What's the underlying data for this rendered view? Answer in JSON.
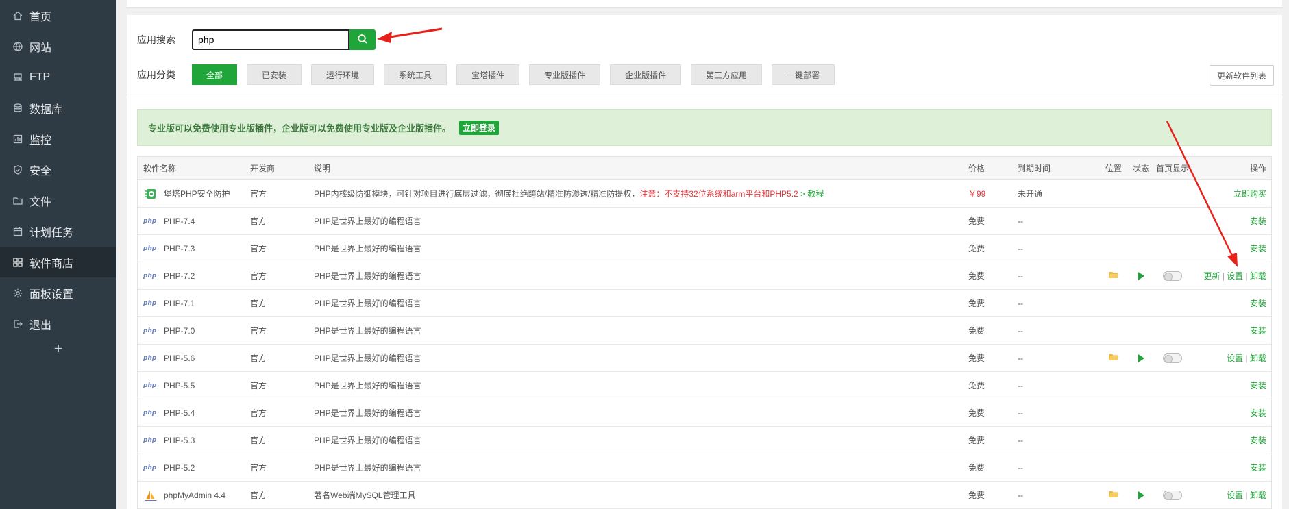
{
  "sidebar": {
    "items": [
      {
        "label": "首页",
        "icon": "home-icon"
      },
      {
        "label": "网站",
        "icon": "globe-icon"
      },
      {
        "label": "FTP",
        "icon": "ftp-icon"
      },
      {
        "label": "数据库",
        "icon": "database-icon"
      },
      {
        "label": "监控",
        "icon": "monitor-icon"
      },
      {
        "label": "安全",
        "icon": "shield-icon"
      },
      {
        "label": "文件",
        "icon": "folder-icon"
      },
      {
        "label": "计划任务",
        "icon": "calendar-icon"
      },
      {
        "label": "软件商店",
        "icon": "grid-icon"
      },
      {
        "label": "面板设置",
        "icon": "gear-icon"
      },
      {
        "label": "退出",
        "icon": "logout-icon"
      }
    ],
    "active_index": 8,
    "add_label": "+"
  },
  "search": {
    "label": "应用搜索",
    "value": "php"
  },
  "categories": {
    "label": "应用分类",
    "items": [
      "全部",
      "已安装",
      "运行环境",
      "系统工具",
      "宝塔插件",
      "专业版插件",
      "企业版插件",
      "第三方应用",
      "一键部署"
    ],
    "active_index": 0,
    "update_label": "更新软件列表"
  },
  "notice": {
    "text": "专业版可以免费使用专业版插件，企业版可以免费使用专业版及企业版插件。",
    "login_label": "立即登录"
  },
  "table": {
    "headers": {
      "name": "软件名称",
      "dev": "开发商",
      "desc": "说明",
      "price": "价格",
      "expire": "到期时间",
      "position": "位置",
      "state": "状态",
      "home": "首页显示",
      "op": "操作"
    },
    "rows": [
      {
        "name": "堡塔PHP安全防护",
        "dev": "官方",
        "desc": "PHP内核级防御模块，可针对项目进行底层过滤，彻底杜绝跨站/精准防渗透/精准防提权，",
        "warn": "注意：不支持32位系统和arm平台和PHP5.2",
        "link": " > 教程",
        "price": "￥99",
        "expire": "未开通",
        "op": "立即购买"
      },
      {
        "name": "PHP-7.4",
        "dev": "官方",
        "desc": "PHP是世界上最好的编程语言",
        "price": "免费",
        "expire": "--",
        "op": "安装"
      },
      {
        "name": "PHP-7.3",
        "dev": "官方",
        "desc": "PHP是世界上最好的编程语言",
        "price": "免费",
        "expire": "--",
        "op": "安装"
      },
      {
        "name": "PHP-7.2",
        "dev": "官方",
        "desc": "PHP是世界上最好的编程语言",
        "price": "免费",
        "expire": "--",
        "op_update": "更新",
        "op_settings": "设置",
        "op_uninstall": "卸载"
      },
      {
        "name": "PHP-7.1",
        "dev": "官方",
        "desc": "PHP是世界上最好的编程语言",
        "price": "免费",
        "expire": "--",
        "op": "安装"
      },
      {
        "name": "PHP-7.0",
        "dev": "官方",
        "desc": "PHP是世界上最好的编程语言",
        "price": "免费",
        "expire": "--",
        "op": "安装"
      },
      {
        "name": "PHP-5.6",
        "dev": "官方",
        "desc": "PHP是世界上最好的编程语言",
        "price": "免费",
        "expire": "--",
        "op_settings": "设置",
        "op_uninstall": "卸载"
      },
      {
        "name": "PHP-5.5",
        "dev": "官方",
        "desc": "PHP是世界上最好的编程语言",
        "price": "免费",
        "expire": "--",
        "op": "安装"
      },
      {
        "name": "PHP-5.4",
        "dev": "官方",
        "desc": "PHP是世界上最好的编程语言",
        "price": "免费",
        "expire": "--",
        "op": "安装"
      },
      {
        "name": "PHP-5.3",
        "dev": "官方",
        "desc": "PHP是世界上最好的编程语言",
        "price": "免费",
        "expire": "--",
        "op": "安装"
      },
      {
        "name": "PHP-5.2",
        "dev": "官方",
        "desc": "PHP是世界上最好的编程语言",
        "price": "免费",
        "expire": "--",
        "op": "安装"
      },
      {
        "name": "phpMyAdmin 4.4",
        "dev": "官方",
        "desc": "著名Web端MySQL管理工具",
        "price": "免费",
        "expire": "--",
        "op_settings": "设置",
        "op_uninstall": "卸载"
      }
    ],
    "php_logo": "php",
    "separator": "|"
  },
  "colors": {
    "sidebar_bg": "#2f3b44",
    "accent_green": "#20a53a",
    "annotation_red": "#e8201a"
  }
}
